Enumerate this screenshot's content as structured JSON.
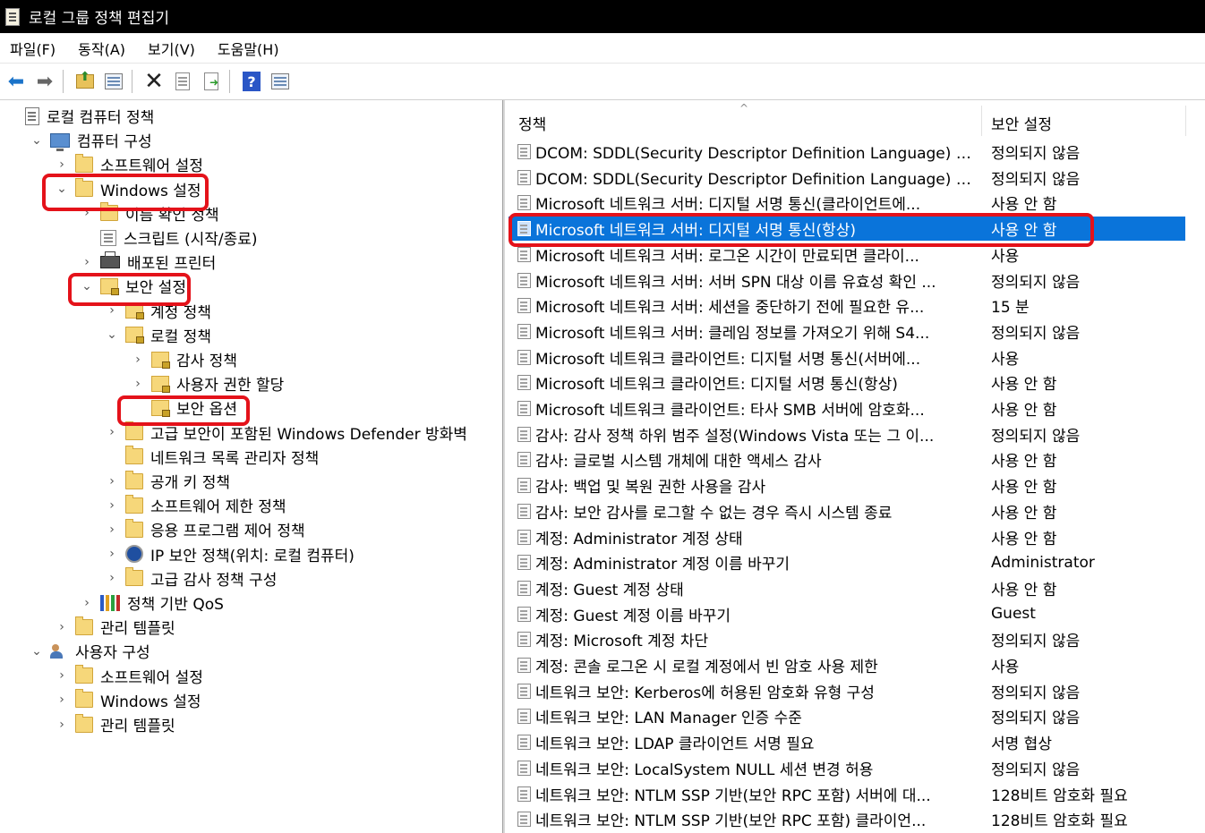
{
  "window": {
    "title": "로컬 그룹 정책 편집기"
  },
  "menu": [
    "파일(F)",
    "동작(A)",
    "보기(V)",
    "도움말(H)"
  ],
  "toolbar": [
    "back-icon",
    "forward-icon",
    "up-folder-icon",
    "show-hide-tree-icon",
    "delete-icon",
    "properties-icon",
    "export-list-icon",
    "help-icon",
    "view-icon"
  ],
  "tree": [
    {
      "label": "로컬 컴퓨터 정책",
      "level": 0,
      "icon": "policy",
      "chev": ""
    },
    {
      "label": "컴퓨터 구성",
      "level": 1,
      "icon": "computer",
      "chev": "v"
    },
    {
      "label": "소프트웨어 설정",
      "level": 2,
      "icon": "folder",
      "chev": ">"
    },
    {
      "label": "Windows 설정",
      "level": 2,
      "icon": "folder",
      "chev": "v"
    },
    {
      "label": "이름 확인 정책",
      "level": 3,
      "icon": "folder",
      "chev": ">"
    },
    {
      "label": "스크립트 (시작/종료)",
      "level": 3,
      "icon": "script",
      "chev": ""
    },
    {
      "label": "배포된 프린터",
      "level": 3,
      "icon": "printer",
      "chev": ">"
    },
    {
      "label": "보안 설정",
      "level": 3,
      "icon": "lockfolder",
      "chev": "v"
    },
    {
      "label": "계정 정책",
      "level": 4,
      "icon": "lockfolder",
      "chev": ">"
    },
    {
      "label": "로컬 정책",
      "level": 4,
      "icon": "lockfolder",
      "chev": "v"
    },
    {
      "label": "감사 정책",
      "level": 5,
      "icon": "lockfolder",
      "chev": ">"
    },
    {
      "label": "사용자 권한 할당",
      "level": 5,
      "icon": "lockfolder",
      "chev": ">"
    },
    {
      "label": "보안 옵션",
      "level": 5,
      "icon": "lockfolder",
      "chev": ""
    },
    {
      "label": "고급 보안이 포함된 Windows Defender 방화벽",
      "level": 4,
      "icon": "folder",
      "chev": ">"
    },
    {
      "label": "네트워크 목록 관리자 정책",
      "level": 4,
      "icon": "folder",
      "chev": ""
    },
    {
      "label": "공개 키 정책",
      "level": 4,
      "icon": "folder",
      "chev": ">"
    },
    {
      "label": "소프트웨어 제한 정책",
      "level": 4,
      "icon": "folder",
      "chev": ">"
    },
    {
      "label": "응용 프로그램 제어 정책",
      "level": 4,
      "icon": "folder",
      "chev": ">"
    },
    {
      "label": "IP 보안 정책(위치: 로컬 컴퓨터)",
      "level": 4,
      "icon": "ipsec",
      "chev": ">"
    },
    {
      "label": "고급 감사 정책 구성",
      "level": 4,
      "icon": "folder",
      "chev": ">"
    },
    {
      "label": "정책 기반 QoS",
      "level": 3,
      "icon": "qos",
      "chev": ">"
    },
    {
      "label": "관리 템플릿",
      "level": 2,
      "icon": "folder",
      "chev": ">"
    },
    {
      "label": "사용자 구성",
      "level": 1,
      "icon": "users",
      "chev": "v"
    },
    {
      "label": "소프트웨어 설정",
      "level": 2,
      "icon": "folder",
      "chev": ">"
    },
    {
      "label": "Windows 설정",
      "level": 2,
      "icon": "folder",
      "chev": ">"
    },
    {
      "label": "관리 템플릿",
      "level": 2,
      "icon": "folder",
      "chev": ">"
    }
  ],
  "list": {
    "col_policy": "정책",
    "col_setting": "보안 설정",
    "selected_index": 3,
    "rows": [
      {
        "name": "DCOM: SDDL(Security Descriptor Definition Language) 구...",
        "value": "정의되지 않음"
      },
      {
        "name": "DCOM: SDDL(Security Descriptor Definition Language) 구...",
        "value": "정의되지 않음"
      },
      {
        "name": "Microsoft 네트워크 서버: 디지털 서명 통신(클라이언트에...",
        "value": "사용 안 함"
      },
      {
        "name": "Microsoft 네트워크 서버: 디지털 서명 통신(항상)",
        "value": "사용 안 함"
      },
      {
        "name": "Microsoft 네트워크 서버: 로그온 시간이 만료되면 클라이...",
        "value": "사용"
      },
      {
        "name": "Microsoft 네트워크 서버: 서버 SPN 대상 이름 유효성 확인 ...",
        "value": "정의되지 않음"
      },
      {
        "name": "Microsoft 네트워크 서버: 세션을 중단하기 전에 필요한 유...",
        "value": "15 분"
      },
      {
        "name": "Microsoft 네트워크 서버: 클레임 정보를 가져오기 위해 S4...",
        "value": "정의되지 않음"
      },
      {
        "name": "Microsoft 네트워크 클라이언트: 디지털 서명 통신(서버에...",
        "value": "사용"
      },
      {
        "name": "Microsoft 네트워크 클라이언트: 디지털 서명 통신(항상)",
        "value": "사용 안 함"
      },
      {
        "name": "Microsoft 네트워크 클라이언트: 타사 SMB 서버에 암호화...",
        "value": "사용 안 함"
      },
      {
        "name": "감사: 감사 정책 하위 범주 설정(Windows Vista 또는 그 이...",
        "value": "정의되지 않음"
      },
      {
        "name": "감사: 글로벌 시스템 개체에 대한 액세스 감사",
        "value": "사용 안 함"
      },
      {
        "name": "감사: 백업 및 복원 권한 사용을 감사",
        "value": "사용 안 함"
      },
      {
        "name": "감사: 보안 감사를 로그할 수 없는 경우 즉시 시스템 종료",
        "value": "사용 안 함"
      },
      {
        "name": "계정: Administrator 계정 상태",
        "value": "사용 안 함"
      },
      {
        "name": "계정: Administrator 계정 이름 바꾸기",
        "value": "Administrator"
      },
      {
        "name": "계정: Guest 계정 상태",
        "value": "사용 안 함"
      },
      {
        "name": "계정: Guest 계정 이름 바꾸기",
        "value": "Guest"
      },
      {
        "name": "계정: Microsoft 계정 차단",
        "value": "정의되지 않음"
      },
      {
        "name": "계정: 콘솔 로그온 시 로컬 계정에서 빈 암호 사용 제한",
        "value": "사용"
      },
      {
        "name": "네트워크 보안: Kerberos에 허용된 암호화 유형 구성",
        "value": "정의되지 않음"
      },
      {
        "name": "네트워크 보안: LAN Manager 인증 수준",
        "value": "정의되지 않음"
      },
      {
        "name": "네트워크 보안: LDAP 클라이언트 서명 필요",
        "value": "서명 협상"
      },
      {
        "name": "네트워크 보안: LocalSystem NULL 세션 변경 허용",
        "value": "정의되지 않음"
      },
      {
        "name": "네트워크 보안: NTLM SSP 기반(보안 RPC 포함) 서버에 대...",
        "value": "128비트 암호화 필요"
      },
      {
        "name": "네트워크 보안: NTLM SSP 기반(보안 RPC 포함) 클라이언...",
        "value": "128비트 암호화 필요"
      }
    ]
  },
  "colors": {
    "selection": "#0a74da",
    "highlight_mark": "#e4121a",
    "titlebar": "#000000"
  }
}
